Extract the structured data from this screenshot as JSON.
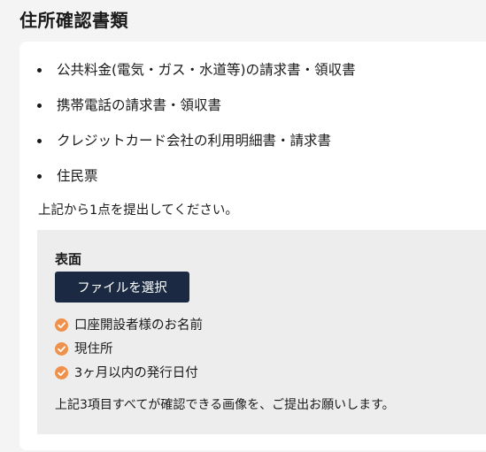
{
  "section": {
    "title": "住所確認書類"
  },
  "documents": [
    "公共料金(電気・ガス・水道等)の請求書・領収書",
    "携帯電話の請求書・領収書",
    "クレジットカード会社の利用明細書・請求書",
    "住民票"
  ],
  "instruction": "上記から1点を提出してください。",
  "upload": {
    "side_label": "表面",
    "button_label": "ファイルを選択",
    "requirements": [
      "口座開設者様のお名前",
      "現住所",
      "3ヶ月以内の発行日付"
    ],
    "note": "上記3項目すべてが確認できる画像を、ご提出お願いします。"
  },
  "colors": {
    "accent_check": "#f0914b",
    "button_bg": "#1b2a42",
    "panel_bg": "#ededed"
  },
  "icons": {
    "requirement": "check-circle-icon",
    "document_bullet": "bullet-dot"
  }
}
